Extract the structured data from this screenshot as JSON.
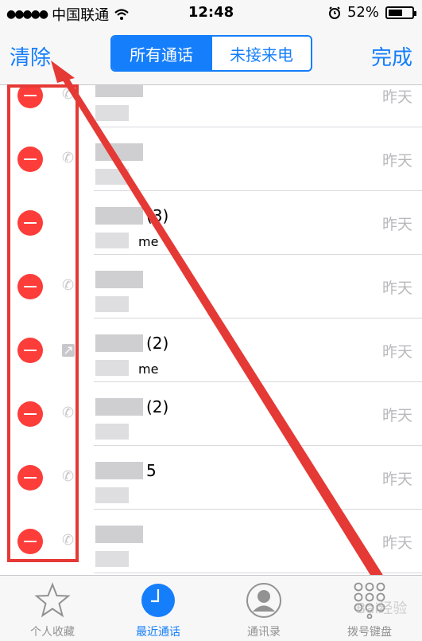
{
  "status_bar": {
    "signal": "●●●●●",
    "carrier": "中国联通",
    "time": "12:48",
    "battery_percent": "52%",
    "battery_level": 0.52
  },
  "nav": {
    "clear_label": "清除",
    "done_label": "完成",
    "segments": [
      "所有通话",
      "未接来电"
    ],
    "active_segment": 0
  },
  "rows": [
    {
      "count": "",
      "sub": "",
      "date": "昨天",
      "call_icon": "phone-icon"
    },
    {
      "count": "",
      "sub": "",
      "date": "昨天",
      "call_icon": "phone-icon"
    },
    {
      "count": "(3)",
      "sub": "me",
      "date": "昨天",
      "call_icon": "none"
    },
    {
      "count": "",
      "sub": "",
      "date": "昨天",
      "call_icon": "phone-icon"
    },
    {
      "count": "(2)",
      "sub": "me",
      "date": "昨天",
      "call_icon": "outgoing-icon"
    },
    {
      "count": "(2)",
      "sub": "",
      "date": "昨天",
      "call_icon": "phone-icon"
    },
    {
      "count": "5",
      "sub": "",
      "date": "昨天",
      "call_icon": "phone-icon"
    },
    {
      "count": "",
      "sub": "",
      "date": "昨天",
      "call_icon": "phone-icon"
    }
  ],
  "tabs": [
    {
      "label": "个人收藏",
      "icon": "star-icon"
    },
    {
      "label": "最近通话",
      "icon": "clock-icon"
    },
    {
      "label": "通讯录",
      "icon": "contact-icon"
    },
    {
      "label": "拨号键盘",
      "icon": "keypad-icon"
    }
  ],
  "active_tab": 1,
  "watermark": "Bai经验",
  "colors": {
    "accent": "#157efb",
    "delete": "#fc3d39",
    "annotation": "#e53935"
  }
}
